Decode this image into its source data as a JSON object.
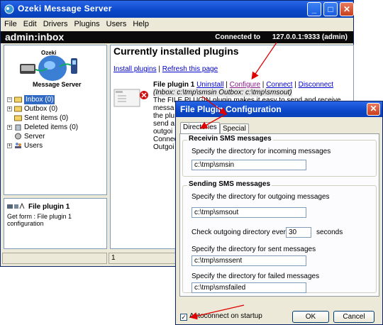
{
  "window": {
    "title": "Ozeki Message Server",
    "controls": [
      "minimize",
      "maximize",
      "close"
    ]
  },
  "menu": [
    "File",
    "Edit",
    "Drivers",
    "Plugins",
    "Users",
    "Help"
  ],
  "header": {
    "account": "admin:inbox",
    "connected_label": "Connected to",
    "connected_value": "127.0.0.1:9333 (admin)"
  },
  "logo": {
    "top": "Ozeki",
    "bottom": "Message Server"
  },
  "tree": [
    {
      "label": "Inbox (0)",
      "selected": true,
      "expander": "minus",
      "icon": "inbox-icon"
    },
    {
      "label": "Outbox (0)",
      "selected": false,
      "expander": "plus",
      "icon": "outbox-icon"
    },
    {
      "label": "Sent items (0)",
      "selected": false,
      "expander": "",
      "icon": "sent-icon"
    },
    {
      "label": "Deleted items (0)",
      "selected": false,
      "expander": "plus",
      "icon": "trash-icon"
    },
    {
      "label": "Server",
      "selected": false,
      "expander": "",
      "icon": "server-icon"
    },
    {
      "label": "Users",
      "selected": false,
      "expander": "plus",
      "icon": "users-icon"
    }
  ],
  "info": {
    "title": "File plugin 1",
    "text": "Get form : File plugin 1 configuration"
  },
  "content": {
    "heading": "Currently installed plugins",
    "install_link": "Install plugins",
    "separator": "|",
    "refresh_link": "Refresh this page",
    "plugin_name": "File plugin 1",
    "uninstall": "Uninstall",
    "configure": "Configure",
    "connect": "Connect",
    "disconnect": "Disconnect",
    "paths_line": "(Inbox: c:\\tmp\\smsin Outbox: c:\\tmp\\smsout)",
    "desc_lines": [
      "The FILE PLUGIN plugin makes it easy to send and receive",
      "messa",
      "the plu",
      "send a",
      "outgoi",
      "Connec",
      "Outgoi"
    ]
  },
  "statusbar": {
    "count": "1"
  },
  "dialog": {
    "title": "File Plugin Configuration",
    "tabs": [
      "Directories",
      "Special"
    ],
    "receive_group": "Receivin SMS messages",
    "incoming_label": "Specify the directory for incoming messages",
    "incoming_value": "c:\\tmp\\smsin",
    "send_group": "Sending SMS messages",
    "outgoing_label": "Specify the directory for outgoing messages",
    "outgoing_value": "c:\\tmp\\smsout",
    "check_label": "Check outgoing directory every",
    "check_value": "30",
    "check_unit": "seconds",
    "sent_label": "Specify the directory for sent messages",
    "sent_value": "c:\\tmp\\smssent",
    "failed_label": "Specify the directory for failed messages",
    "failed_value": "c:\\tmp\\smsfailed",
    "autoconnect_label": "Autoconnect on startup",
    "autoconnect_checked": true,
    "ok": "OK",
    "cancel": "Cancel"
  },
  "colors": {
    "titlebar": "#0a47c8",
    "header": "#0a0a0a",
    "selection": "#316ac5",
    "link": "#0000cc",
    "annotation_arrow": "#e00000"
  }
}
